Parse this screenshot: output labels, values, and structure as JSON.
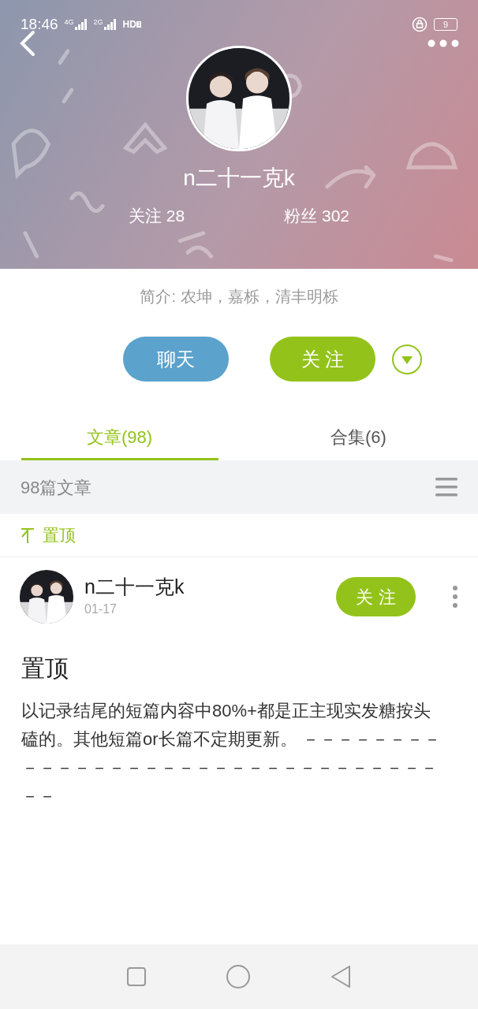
{
  "status_bar": {
    "time": "18:46",
    "networks": [
      "4G",
      "2G"
    ],
    "hd": "HD",
    "sim": "1",
    "battery": "9"
  },
  "profile": {
    "name": "n二十一克k",
    "stats": [
      {
        "label": "关注",
        "value": "28"
      },
      {
        "label": "粉丝",
        "value": "302"
      }
    ],
    "bio": "简介: 农坤，嘉栎，清丰明栎"
  },
  "actions": [
    {
      "label": "聊天",
      "kind": "chat"
    },
    {
      "label": "关 注",
      "kind": "follow"
    }
  ],
  "tabs": [
    {
      "label": "文章(98)",
      "selected": true
    },
    {
      "label": "合集(6)",
      "selected": false
    }
  ],
  "list_header": {
    "count": "98篇文章"
  },
  "pinned": {
    "label": "置顶"
  },
  "post": {
    "author": "n二十一克k",
    "date": "01-17",
    "follow_label": "关 注",
    "title": "置顶",
    "body": "以记录结尾的短篇内容中80%+都是正主现实发糖按头磕的。其他短篇or长篇不定期更新。 －－－－－－－－－－－－－－－－－－－－－－－－－－－－－－－－－－"
  }
}
